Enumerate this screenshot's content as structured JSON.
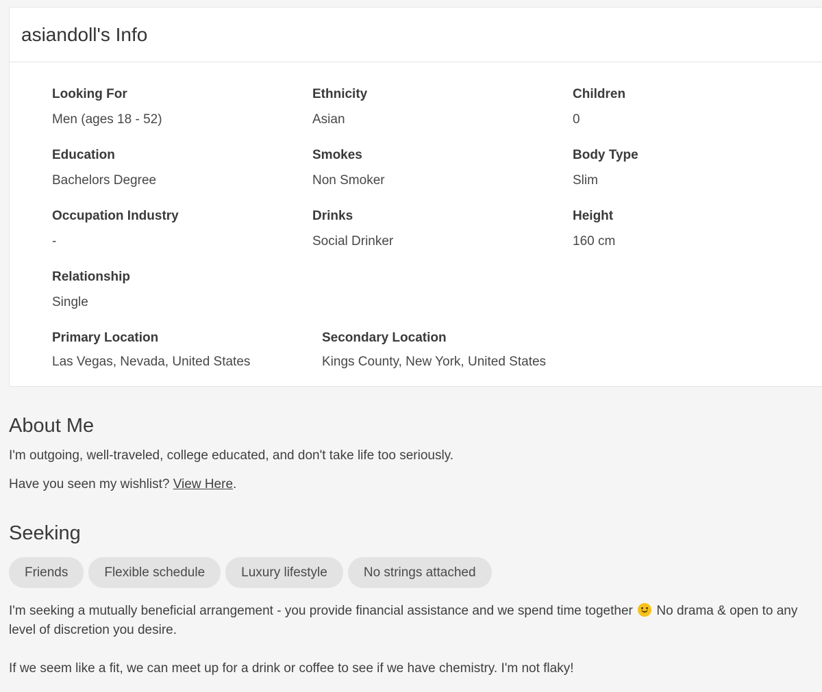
{
  "info_card": {
    "title": "asiandoll's Info",
    "rows": [
      [
        {
          "label": "Looking For",
          "value": "Men (ages 18 - 52)"
        },
        {
          "label": "Ethnicity",
          "value": "Asian"
        },
        {
          "label": "Children",
          "value": "0"
        }
      ],
      [
        {
          "label": "Education",
          "value": "Bachelors Degree"
        },
        {
          "label": "Smokes",
          "value": "Non Smoker"
        },
        {
          "label": "Body Type",
          "value": "Slim"
        }
      ],
      [
        {
          "label": "Occupation Industry",
          "value": "-"
        },
        {
          "label": "Drinks",
          "value": "Social Drinker"
        },
        {
          "label": "Height",
          "value": "160 cm"
        }
      ],
      [
        {
          "label": "Relationship",
          "value": "Single"
        }
      ],
      [
        {
          "label": "Primary Location",
          "value": "Las Vegas, Nevada, United States"
        },
        {
          "label": "Secondary Location",
          "value": "Kings County, New York, United States"
        }
      ]
    ]
  },
  "about": {
    "title": "About Me",
    "text": "I'm outgoing, well-traveled, college educated, and don't take life too seriously.",
    "wishlist_prefix": "Have you seen my wishlist?",
    "wishlist_link": "View Here",
    "wishlist_suffix": "."
  },
  "seeking": {
    "title": "Seeking",
    "chips": [
      "Friends",
      "Flexible schedule",
      "Luxury lifestyle",
      "No strings attached"
    ],
    "text_before_emoji": "I'm seeking a mutually beneficial arrangement - you provide financial assistance and we spend time together",
    "emoji_icon": "smiling-face-icon",
    "text_after_emoji": "No drama & open to any level of discretion you desire.",
    "text2": "If we seem like a fit, we can meet up for a drink or coffee to see if we have chemistry. I'm not flaky!"
  }
}
